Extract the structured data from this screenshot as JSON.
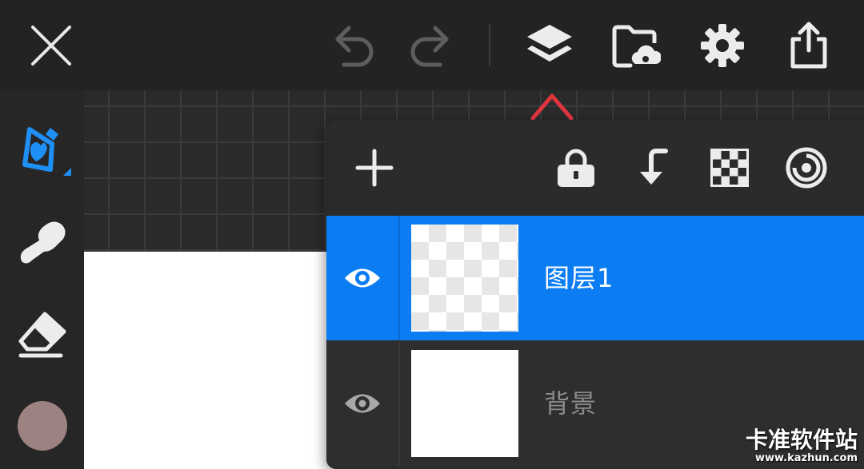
{
  "toolbar": {
    "close": {
      "icon": "close-icon"
    },
    "undo": {
      "icon": "undo-icon",
      "enabled": false
    },
    "redo": {
      "icon": "redo-icon",
      "enabled": false
    },
    "layers": {
      "icon": "layers-icon",
      "active": true
    },
    "gallery": {
      "icon": "folder-cloud-icon"
    },
    "settings": {
      "icon": "gear-icon"
    },
    "share": {
      "icon": "share-icon"
    }
  },
  "tools": [
    {
      "name": "brush",
      "icon": "pen-icon",
      "active": true
    },
    {
      "name": "smudge",
      "icon": "smudge-icon"
    },
    {
      "name": "eraser",
      "icon": "eraser-icon"
    },
    {
      "name": "color",
      "icon": "color-swatch",
      "color": "#9c8280"
    }
  ],
  "layers_panel": {
    "actions": [
      {
        "name": "add-layer",
        "icon": "plus-icon"
      },
      {
        "name": "lock",
        "icon": "lock-icon"
      },
      {
        "name": "merge-down",
        "icon": "merge-down-icon"
      },
      {
        "name": "alpha-lock",
        "icon": "checkerboard-icon"
      },
      {
        "name": "blend",
        "icon": "target-icon"
      }
    ],
    "layers": [
      {
        "name": "图层1",
        "visible": true,
        "selected": true,
        "thumbnail": "transparent"
      },
      {
        "name": "背景",
        "visible": true,
        "selected": false,
        "thumbnail": "white"
      }
    ]
  },
  "watermark": {
    "title": "卡准软件站",
    "url": "www.kazhun.com"
  },
  "colors": {
    "accent": "#0b7cf2",
    "arrow": "#e0353d",
    "toolbar_bg": "#232324",
    "panel_bg": "#2b2b2c"
  }
}
